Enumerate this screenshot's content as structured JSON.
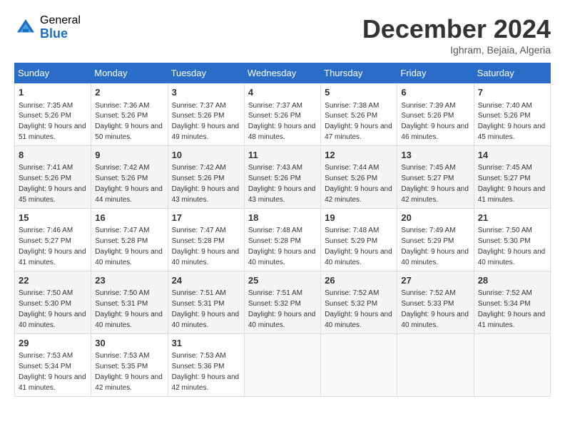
{
  "header": {
    "logo_general": "General",
    "logo_blue": "Blue",
    "month_year": "December 2024",
    "location": "Ighram, Bejaia, Algeria"
  },
  "days_of_week": [
    "Sunday",
    "Monday",
    "Tuesday",
    "Wednesday",
    "Thursday",
    "Friday",
    "Saturday"
  ],
  "weeks": [
    [
      {
        "day": "1",
        "sunrise": "7:35 AM",
        "sunset": "5:26 PM",
        "daylight": "9 hours and 51 minutes."
      },
      {
        "day": "2",
        "sunrise": "7:36 AM",
        "sunset": "5:26 PM",
        "daylight": "9 hours and 50 minutes."
      },
      {
        "day": "3",
        "sunrise": "7:37 AM",
        "sunset": "5:26 PM",
        "daylight": "9 hours and 49 minutes."
      },
      {
        "day": "4",
        "sunrise": "7:37 AM",
        "sunset": "5:26 PM",
        "daylight": "9 hours and 48 minutes."
      },
      {
        "day": "5",
        "sunrise": "7:38 AM",
        "sunset": "5:26 PM",
        "daylight": "9 hours and 47 minutes."
      },
      {
        "day": "6",
        "sunrise": "7:39 AM",
        "sunset": "5:26 PM",
        "daylight": "9 hours and 46 minutes."
      },
      {
        "day": "7",
        "sunrise": "7:40 AM",
        "sunset": "5:26 PM",
        "daylight": "9 hours and 45 minutes."
      }
    ],
    [
      {
        "day": "8",
        "sunrise": "7:41 AM",
        "sunset": "5:26 PM",
        "daylight": "9 hours and 45 minutes."
      },
      {
        "day": "9",
        "sunrise": "7:42 AM",
        "sunset": "5:26 PM",
        "daylight": "9 hours and 44 minutes."
      },
      {
        "day": "10",
        "sunrise": "7:42 AM",
        "sunset": "5:26 PM",
        "daylight": "9 hours and 43 minutes."
      },
      {
        "day": "11",
        "sunrise": "7:43 AM",
        "sunset": "5:26 PM",
        "daylight": "9 hours and 43 minutes."
      },
      {
        "day": "12",
        "sunrise": "7:44 AM",
        "sunset": "5:26 PM",
        "daylight": "9 hours and 42 minutes."
      },
      {
        "day": "13",
        "sunrise": "7:45 AM",
        "sunset": "5:27 PM",
        "daylight": "9 hours and 42 minutes."
      },
      {
        "day": "14",
        "sunrise": "7:45 AM",
        "sunset": "5:27 PM",
        "daylight": "9 hours and 41 minutes."
      }
    ],
    [
      {
        "day": "15",
        "sunrise": "7:46 AM",
        "sunset": "5:27 PM",
        "daylight": "9 hours and 41 minutes."
      },
      {
        "day": "16",
        "sunrise": "7:47 AM",
        "sunset": "5:28 PM",
        "daylight": "9 hours and 40 minutes."
      },
      {
        "day": "17",
        "sunrise": "7:47 AM",
        "sunset": "5:28 PM",
        "daylight": "9 hours and 40 minutes."
      },
      {
        "day": "18",
        "sunrise": "7:48 AM",
        "sunset": "5:28 PM",
        "daylight": "9 hours and 40 minutes."
      },
      {
        "day": "19",
        "sunrise": "7:48 AM",
        "sunset": "5:29 PM",
        "daylight": "9 hours and 40 minutes."
      },
      {
        "day": "20",
        "sunrise": "7:49 AM",
        "sunset": "5:29 PM",
        "daylight": "9 hours and 40 minutes."
      },
      {
        "day": "21",
        "sunrise": "7:50 AM",
        "sunset": "5:30 PM",
        "daylight": "9 hours and 40 minutes."
      }
    ],
    [
      {
        "day": "22",
        "sunrise": "7:50 AM",
        "sunset": "5:30 PM",
        "daylight": "9 hours and 40 minutes."
      },
      {
        "day": "23",
        "sunrise": "7:50 AM",
        "sunset": "5:31 PM",
        "daylight": "9 hours and 40 minutes."
      },
      {
        "day": "24",
        "sunrise": "7:51 AM",
        "sunset": "5:31 PM",
        "daylight": "9 hours and 40 minutes."
      },
      {
        "day": "25",
        "sunrise": "7:51 AM",
        "sunset": "5:32 PM",
        "daylight": "9 hours and 40 minutes."
      },
      {
        "day": "26",
        "sunrise": "7:52 AM",
        "sunset": "5:32 PM",
        "daylight": "9 hours and 40 minutes."
      },
      {
        "day": "27",
        "sunrise": "7:52 AM",
        "sunset": "5:33 PM",
        "daylight": "9 hours and 40 minutes."
      },
      {
        "day": "28",
        "sunrise": "7:52 AM",
        "sunset": "5:34 PM",
        "daylight": "9 hours and 41 minutes."
      }
    ],
    [
      {
        "day": "29",
        "sunrise": "7:53 AM",
        "sunset": "5:34 PM",
        "daylight": "9 hours and 41 minutes."
      },
      {
        "day": "30",
        "sunrise": "7:53 AM",
        "sunset": "5:35 PM",
        "daylight": "9 hours and 42 minutes."
      },
      {
        "day": "31",
        "sunrise": "7:53 AM",
        "sunset": "5:36 PM",
        "daylight": "9 hours and 42 minutes."
      },
      null,
      null,
      null,
      null
    ]
  ]
}
